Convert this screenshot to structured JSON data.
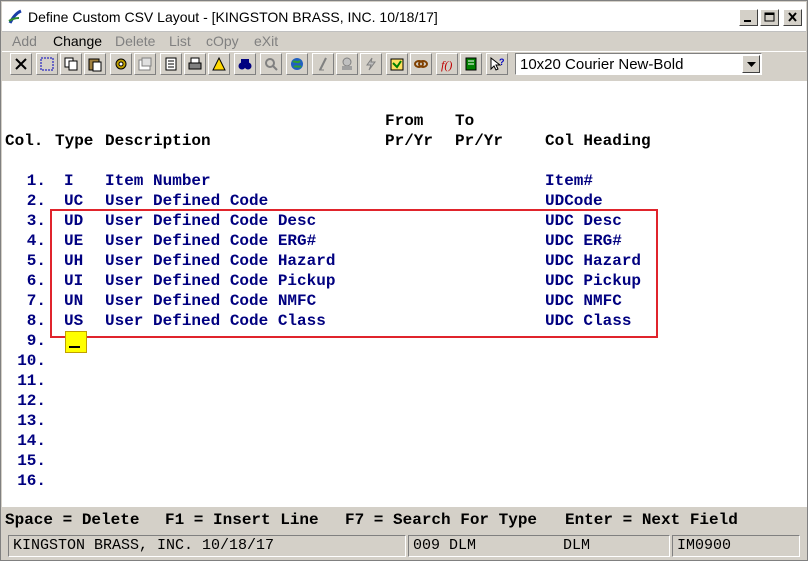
{
  "window": {
    "title": "Define Custom CSV Layout - [KINGSTON BRASS, INC. 10/18/17]"
  },
  "menu": [
    {
      "label": "Add",
      "enabled": false
    },
    {
      "label": "Change",
      "enabled": true
    },
    {
      "label": "Delete",
      "enabled": false
    },
    {
      "label": "List",
      "enabled": false
    },
    {
      "label": "cOpy",
      "enabled": false
    },
    {
      "label": "eXit",
      "enabled": false
    }
  ],
  "toolbar": {
    "icons": [
      "close-x-icon",
      "select-icon",
      "copy-icon",
      "paste-icon",
      "gear-icon",
      "properties-icon",
      "document-icon",
      "print-icon",
      "alert-icon",
      "binoculars-icon",
      "magnifier-icon",
      "globe-icon",
      "script-icon",
      "stamp-icon",
      "lightning-icon",
      "note-icon",
      "link-icon",
      "function-icon",
      "book-icon",
      "help-pointer-icon"
    ],
    "font_select_value": "10x20 Courier New-Bold"
  },
  "screen": {
    "header_line1": {
      "from": "From",
      "to": "To"
    },
    "header_line2": {
      "col": "Col.",
      "type": "Type",
      "description": "Description",
      "from": "Pr/Yr",
      "to": "Pr/Yr",
      "col_heading": "Col Heading"
    },
    "rows": [
      {
        "num": "1.",
        "type": "I",
        "description": "Item Number",
        "heading": "Item#"
      },
      {
        "num": "2.",
        "type": "UC",
        "description": "User Defined Code",
        "heading": "UDCode"
      },
      {
        "num": "3.",
        "type": "UD",
        "description": "User Defined Code Desc",
        "heading": "UDC Desc"
      },
      {
        "num": "4.",
        "type": "UE",
        "description": "User Defined Code ERG#",
        "heading": "UDC ERG#"
      },
      {
        "num": "5.",
        "type": "UH",
        "description": "User Defined Code Hazard",
        "heading": "UDC Hazard"
      },
      {
        "num": "6.",
        "type": "UI",
        "description": "User Defined Code Pickup",
        "heading": "UDC Pickup"
      },
      {
        "num": "7.",
        "type": "UN",
        "description": "User Defined Code NMFC",
        "heading": "UDC NMFC"
      },
      {
        "num": "8.",
        "type": "US",
        "description": "User Defined Code Class",
        "heading": "UDC Class"
      },
      {
        "num": "9.",
        "type": "",
        "description": "",
        "heading": ""
      },
      {
        "num": "10.",
        "type": "",
        "description": "",
        "heading": ""
      },
      {
        "num": "11.",
        "type": "",
        "description": "",
        "heading": ""
      },
      {
        "num": "12.",
        "type": "",
        "description": "",
        "heading": ""
      },
      {
        "num": "13.",
        "type": "",
        "description": "",
        "heading": ""
      },
      {
        "num": "14.",
        "type": "",
        "description": "",
        "heading": ""
      },
      {
        "num": "15.",
        "type": "",
        "description": "",
        "heading": ""
      },
      {
        "num": "16.",
        "type": "",
        "description": "",
        "heading": ""
      }
    ]
  },
  "fkeys": {
    "space": "Space = Delete",
    "f1": "F1 = Insert Line",
    "f7": "F7 = Search For Type",
    "enter": "Enter = Next Field"
  },
  "status": {
    "company": "KINGSTON BRASS, INC. 10/18/17",
    "session": "009 DLM",
    "user": "DLM",
    "program": "IM0900"
  },
  "colors": {
    "accent_box": "#e0242c",
    "data_text": "#000080",
    "cursor": "#ffff00"
  }
}
